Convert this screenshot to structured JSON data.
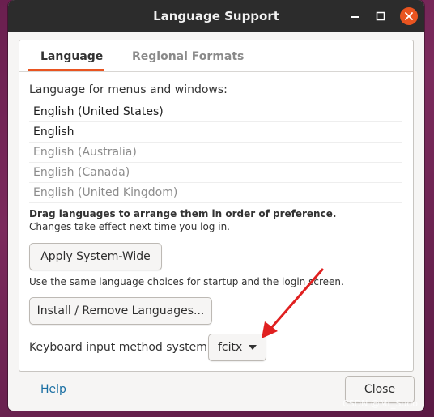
{
  "window": {
    "title": "Language Support"
  },
  "tabs": [
    {
      "label": "Language",
      "active": true
    },
    {
      "label": "Regional Formats",
      "active": false
    }
  ],
  "language": {
    "menus_label": "Language for menus and windows:",
    "languages": [
      {
        "label": "English (United States)",
        "state": "active"
      },
      {
        "label": "English",
        "state": "active"
      },
      {
        "label": "English (Australia)",
        "state": "inactive"
      },
      {
        "label": "English (Canada)",
        "state": "inactive"
      },
      {
        "label": "English (United Kingdom)",
        "state": "inactive"
      }
    ],
    "drag_hint": "Drag languages to arrange them in order of preference.",
    "changes_hint": "Changes take effect next time you log in.",
    "apply_button": "Apply System-Wide",
    "same_choices_text": "Use the same language choices for startup and the login screen.",
    "install_button": "Install / Remove Languages...",
    "keyboard_label": "Keyboard input method system:",
    "keyboard_value": "fcitx"
  },
  "footer": {
    "help": "Help",
    "close": "Close"
  },
  "watermark": "CSDN @Mr_Sudo",
  "colors": {
    "accent": "#e95420",
    "titlebar": "#2c2c2c",
    "link": "#1a6fa3",
    "annotation_arrow": "#e02020"
  },
  "icons": [
    "minimize-icon",
    "maximize-icon",
    "close-icon",
    "dropdown-arrow-icon"
  ]
}
